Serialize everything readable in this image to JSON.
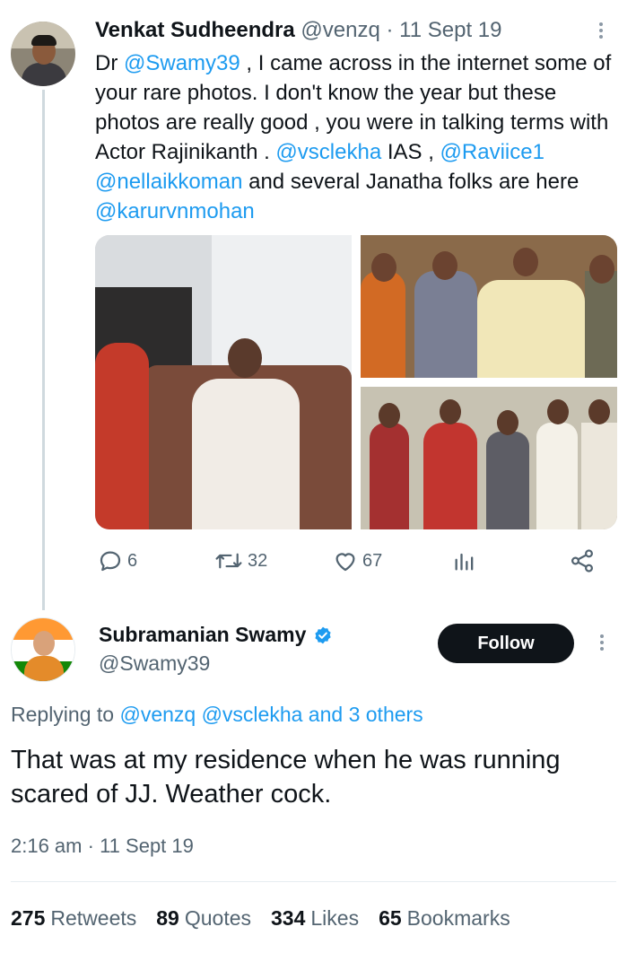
{
  "parent_tweet": {
    "author_name": "Venkat Sudheendra",
    "handle": "@venzq",
    "separator": "·",
    "date": "11 Sept 19",
    "text": {
      "t1": "Dr ",
      "m1": "@Swamy39",
      "t2": " , I came across in the internet some of your rare photos. I don't know the year but these photos are really good , you were in talking terms with Actor Rajinikanth . ",
      "m2": "@vsclekha",
      "t3": " IAS ,  ",
      "m3": "@Raviice1",
      "t4": " ",
      "m4": "@nellaikkoman",
      "t5": " and several Janatha folks are here ",
      "m5": "@karurvnmohan"
    },
    "actions": {
      "replies": "6",
      "retweets": "32",
      "likes": "67"
    },
    "icons": [
      "reply-icon",
      "retweet-icon",
      "like-icon",
      "analytics-icon",
      "share-icon",
      "more-icon"
    ]
  },
  "reply_tweet": {
    "author_name": "Subramanian Swamy",
    "handle": "@Swamy39",
    "follow_label": "Follow",
    "replying_prefix": "Replying to ",
    "replying_to": "@venzq @vsclekha",
    "replying_suffix": " and 3 others",
    "text": "That was at my residence when he was running scared of JJ. Weather cock.",
    "time": "2:16 am",
    "separator": "·",
    "date": "11 Sept 19",
    "stats": [
      {
        "count": "275",
        "label": "Retweets"
      },
      {
        "count": "89",
        "label": "Quotes"
      },
      {
        "count": "334",
        "label": "Likes"
      },
      {
        "count": "65",
        "label": "Bookmarks"
      }
    ]
  },
  "colors": {
    "link": "#1d9bf0",
    "muted": "#536471",
    "text": "#0f1419",
    "follow_bg": "#0f1419",
    "verified": "#1d9bf0"
  }
}
